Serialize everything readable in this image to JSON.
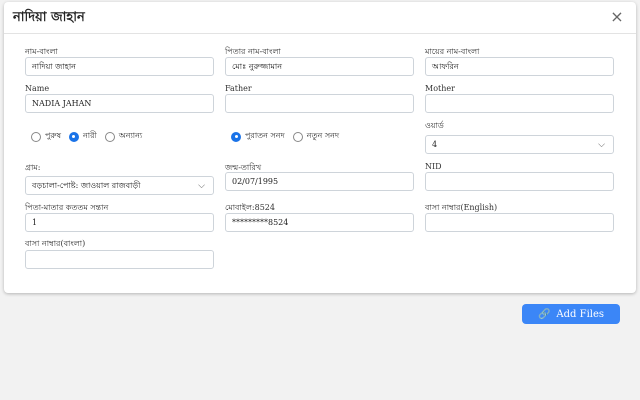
{
  "modal": {
    "title": "নাদিয়া জাহান",
    "close_glyph": "×"
  },
  "fields": {
    "name_bn": {
      "label": "নাম-বাংলা",
      "value": "নাদিয়া জাহান"
    },
    "father_bn": {
      "label": "পিতার নাম-বাংলা",
      "value": "মোঃ নুরুজ্জামান"
    },
    "mother_bn": {
      "label": "মায়ের নাম-বাংলা",
      "value": "আফরিন"
    },
    "name_en": {
      "label": "Name",
      "value": "NADIA JAHAN"
    },
    "father_en": {
      "label": "Father",
      "value": ""
    },
    "mother_en": {
      "label": "Mother",
      "value": ""
    },
    "ward": {
      "label": "ওয়ার্ড",
      "value": "4"
    },
    "village": {
      "label": "গ্রাম:",
      "value": "বড়চালা-পোষ্ট: জাওয়াল রাজবাড়ী"
    },
    "dob": {
      "label": "জন্ম-তারিখ",
      "value": "02/07/1995"
    },
    "nid": {
      "label": "NID",
      "value": ""
    },
    "child_rank": {
      "label": "পিতা-মাতার কততম সন্তান",
      "value": "1"
    },
    "mobile": {
      "label": "মোবাইল:8524",
      "value": "*********8524"
    },
    "house_en": {
      "label": "বাসা নাম্বার(English)",
      "value": ""
    },
    "house_bn": {
      "label": "বাসা নাম্বার(বাংলা)",
      "value": ""
    }
  },
  "gender": {
    "options": [
      "পুরুষ",
      "নারী",
      "অন্যান্য"
    ],
    "selected": "নারী"
  },
  "certificate": {
    "options": [
      "পুরাতন সনদ",
      "নতুন সনদ"
    ],
    "selected": "পুরাতন সনদ"
  },
  "actions": {
    "add_files": "Add Files",
    "clip_glyph": "🔗"
  },
  "colors": {
    "primary": "#3b86f7",
    "radio_active": "#1a73e8"
  }
}
